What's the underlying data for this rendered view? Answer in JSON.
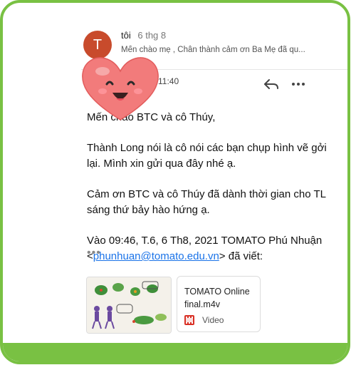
{
  "thread_item": {
    "avatar_letter": "T",
    "sender": "tôi",
    "date": "6 thg 8",
    "snippet": "Mến chào mẹ , Chân thành cảm ơn Ba Mẹ đã qu..."
  },
  "message": {
    "time": "11:40",
    "paragraphs": [
      "Mến chào BTC và cô Thúy,",
      "Thành Long nói là cô nói các bạn chụp hình vẽ gởi lại. Mình xin gửi qua đây nhé ạ.",
      "Cảm ơn BTC và cô Thúy đã dành thời gian cho TL sáng thứ bảy hào hứng ạ."
    ],
    "quote_intro": "Vào 09:46, T.6, 6 Th8, 2021 TOMATO Phú Nhuận <",
    "quote_email": "phunhuan@tomato.edu.vn",
    "quote_outro": "> đã viết:",
    "ellipsis": "•••"
  },
  "attachment": {
    "name": "TOMATO Online final.m4v",
    "type": "Video"
  },
  "icons": {
    "reply": "reply-icon",
    "more": "more-icon",
    "heart": "heart-emoji-sticker",
    "video": "video-file-icon"
  },
  "colors": {
    "frame_green": "#79c143",
    "avatar": "#c84b2c",
    "heart": "#f07a7a",
    "link": "#1a73e8"
  }
}
